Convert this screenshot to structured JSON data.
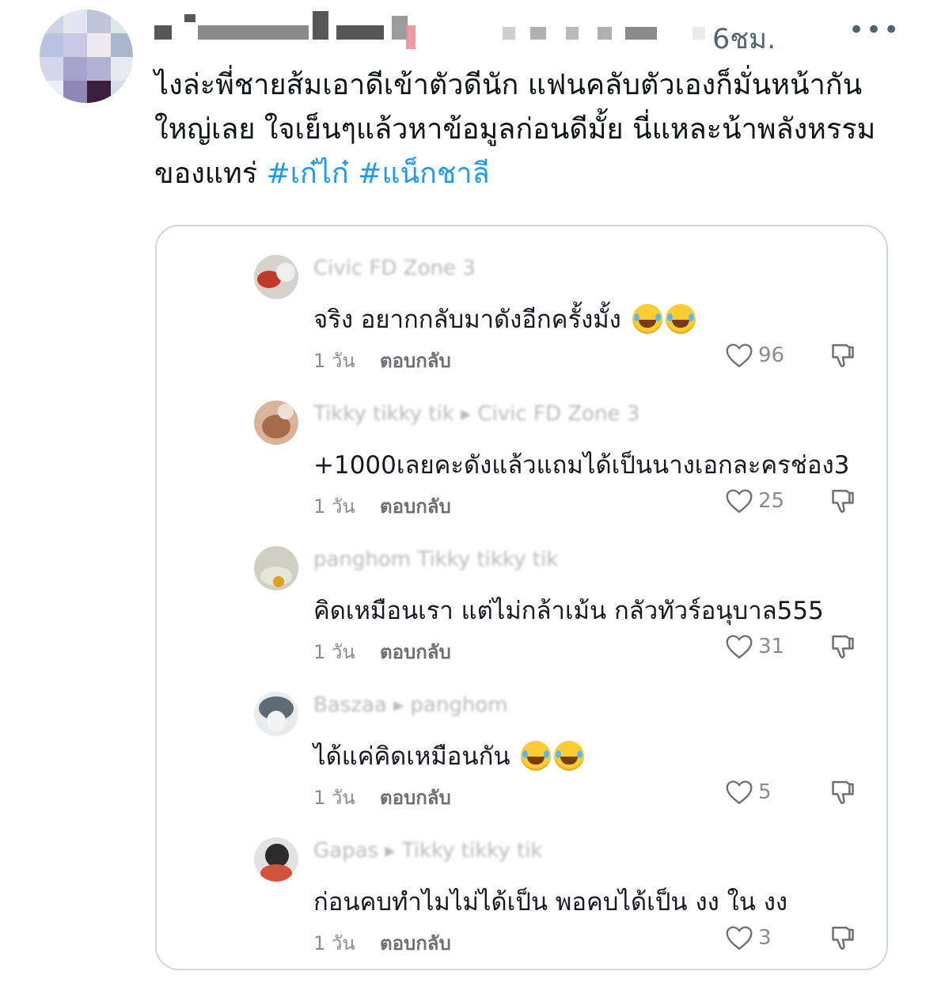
{
  "tweet": {
    "time": "6ชม.",
    "more_label": "•••",
    "text_main": "ไงล่ะพี่ชายส้มเอาดีเข้าตัวดีนัก แฟนคลับตัวเองก็มั่นหน้ากันใหญ่เลย ใจเย็นๆแล้วหาข้อมูลก่อนดีมั้ย นี่แหละน้าพลังหรรมของแทร่ ",
    "hashtags": [
      "#เก๋ไก๋",
      "#แน็กชาลี"
    ]
  },
  "comments": [
    {
      "user": "Civic FD Zone 3",
      "text": "จริง อยากกลับมาดังอีกครั้งมั้ง",
      "emoji_count": 2,
      "time": "1 วัน",
      "reply_label": "ตอบกลับ",
      "likes": "96"
    },
    {
      "user": "Tikky tikky tik ▸ Civic FD Zone 3",
      "text": "+1000เลยคะดังแล้วแถมได้เป็นนางเอกละครช่อง3",
      "emoji_count": 0,
      "time": "1 วัน",
      "reply_label": "ตอบกลับ",
      "likes": "25"
    },
    {
      "user": "panghom Tikky tikky tik",
      "text": "คิดเหมือนเรา แต่ไม่กล้าเม้น กลัวทัวร์อนุบาล555",
      "emoji_count": 0,
      "time": "1 วัน",
      "reply_label": "ตอบกลับ",
      "likes": "31"
    },
    {
      "user": "Baszaa ▸ panghom",
      "text": "ได้แค่คิดเหมือนกัน",
      "emoji_count": 2,
      "time": "1 วัน",
      "reply_label": "ตอบกลับ",
      "likes": "5"
    },
    {
      "user": "Gapas ▸ Tikky tikky tik",
      "text": "ก่อนคบทำไมไม่ได้เป็น พอคบได้เป็น งง ใน งง",
      "emoji_count": 0,
      "time": "1 วัน",
      "reply_label": "ตอบกลับ",
      "likes": "3"
    }
  ],
  "colors": {
    "hashtag": "#1d9bf0",
    "muted": "#536471",
    "card_border": "#cfd9de",
    "comment_text": "#161823"
  },
  "icons": {
    "like": "heart-outline-icon",
    "dislike": "thumbs-down-icon",
    "more": "ellipsis-icon"
  }
}
